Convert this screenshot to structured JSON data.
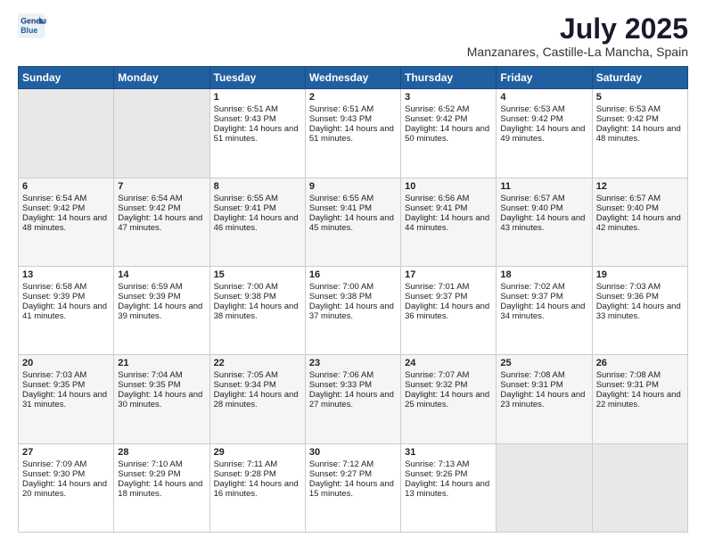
{
  "header": {
    "logo_line1": "General",
    "logo_line2": "Blue",
    "title": "July 2025",
    "subtitle": "Manzanares, Castille-La Mancha, Spain"
  },
  "days_of_week": [
    "Sunday",
    "Monday",
    "Tuesday",
    "Wednesday",
    "Thursday",
    "Friday",
    "Saturday"
  ],
  "weeks": [
    [
      {
        "day": "",
        "empty": true
      },
      {
        "day": "",
        "empty": true
      },
      {
        "day": "1",
        "sunrise": "6:51 AM",
        "sunset": "9:43 PM",
        "daylight": "14 hours and 51 minutes."
      },
      {
        "day": "2",
        "sunrise": "6:51 AM",
        "sunset": "9:43 PM",
        "daylight": "14 hours and 51 minutes."
      },
      {
        "day": "3",
        "sunrise": "6:52 AM",
        "sunset": "9:42 PM",
        "daylight": "14 hours and 50 minutes."
      },
      {
        "day": "4",
        "sunrise": "6:53 AM",
        "sunset": "9:42 PM",
        "daylight": "14 hours and 49 minutes."
      },
      {
        "day": "5",
        "sunrise": "6:53 AM",
        "sunset": "9:42 PM",
        "daylight": "14 hours and 48 minutes."
      }
    ],
    [
      {
        "day": "6",
        "sunrise": "6:54 AM",
        "sunset": "9:42 PM",
        "daylight": "14 hours and 48 minutes."
      },
      {
        "day": "7",
        "sunrise": "6:54 AM",
        "sunset": "9:42 PM",
        "daylight": "14 hours and 47 minutes."
      },
      {
        "day": "8",
        "sunrise": "6:55 AM",
        "sunset": "9:41 PM",
        "daylight": "14 hours and 46 minutes."
      },
      {
        "day": "9",
        "sunrise": "6:55 AM",
        "sunset": "9:41 PM",
        "daylight": "14 hours and 45 minutes."
      },
      {
        "day": "10",
        "sunrise": "6:56 AM",
        "sunset": "9:41 PM",
        "daylight": "14 hours and 44 minutes."
      },
      {
        "day": "11",
        "sunrise": "6:57 AM",
        "sunset": "9:40 PM",
        "daylight": "14 hours and 43 minutes."
      },
      {
        "day": "12",
        "sunrise": "6:57 AM",
        "sunset": "9:40 PM",
        "daylight": "14 hours and 42 minutes."
      }
    ],
    [
      {
        "day": "13",
        "sunrise": "6:58 AM",
        "sunset": "9:39 PM",
        "daylight": "14 hours and 41 minutes."
      },
      {
        "day": "14",
        "sunrise": "6:59 AM",
        "sunset": "9:39 PM",
        "daylight": "14 hours and 39 minutes."
      },
      {
        "day": "15",
        "sunrise": "7:00 AM",
        "sunset": "9:38 PM",
        "daylight": "14 hours and 38 minutes."
      },
      {
        "day": "16",
        "sunrise": "7:00 AM",
        "sunset": "9:38 PM",
        "daylight": "14 hours and 37 minutes."
      },
      {
        "day": "17",
        "sunrise": "7:01 AM",
        "sunset": "9:37 PM",
        "daylight": "14 hours and 36 minutes."
      },
      {
        "day": "18",
        "sunrise": "7:02 AM",
        "sunset": "9:37 PM",
        "daylight": "14 hours and 34 minutes."
      },
      {
        "day": "19",
        "sunrise": "7:03 AM",
        "sunset": "9:36 PM",
        "daylight": "14 hours and 33 minutes."
      }
    ],
    [
      {
        "day": "20",
        "sunrise": "7:03 AM",
        "sunset": "9:35 PM",
        "daylight": "14 hours and 31 minutes."
      },
      {
        "day": "21",
        "sunrise": "7:04 AM",
        "sunset": "9:35 PM",
        "daylight": "14 hours and 30 minutes."
      },
      {
        "day": "22",
        "sunrise": "7:05 AM",
        "sunset": "9:34 PM",
        "daylight": "14 hours and 28 minutes."
      },
      {
        "day": "23",
        "sunrise": "7:06 AM",
        "sunset": "9:33 PM",
        "daylight": "14 hours and 27 minutes."
      },
      {
        "day": "24",
        "sunrise": "7:07 AM",
        "sunset": "9:32 PM",
        "daylight": "14 hours and 25 minutes."
      },
      {
        "day": "25",
        "sunrise": "7:08 AM",
        "sunset": "9:31 PM",
        "daylight": "14 hours and 23 minutes."
      },
      {
        "day": "26",
        "sunrise": "7:08 AM",
        "sunset": "9:31 PM",
        "daylight": "14 hours and 22 minutes."
      }
    ],
    [
      {
        "day": "27",
        "sunrise": "7:09 AM",
        "sunset": "9:30 PM",
        "daylight": "14 hours and 20 minutes."
      },
      {
        "day": "28",
        "sunrise": "7:10 AM",
        "sunset": "9:29 PM",
        "daylight": "14 hours and 18 minutes."
      },
      {
        "day": "29",
        "sunrise": "7:11 AM",
        "sunset": "9:28 PM",
        "daylight": "14 hours and 16 minutes."
      },
      {
        "day": "30",
        "sunrise": "7:12 AM",
        "sunset": "9:27 PM",
        "daylight": "14 hours and 15 minutes."
      },
      {
        "day": "31",
        "sunrise": "7:13 AM",
        "sunset": "9:26 PM",
        "daylight": "14 hours and 13 minutes."
      },
      {
        "day": "",
        "empty": true
      },
      {
        "day": "",
        "empty": true
      }
    ]
  ]
}
